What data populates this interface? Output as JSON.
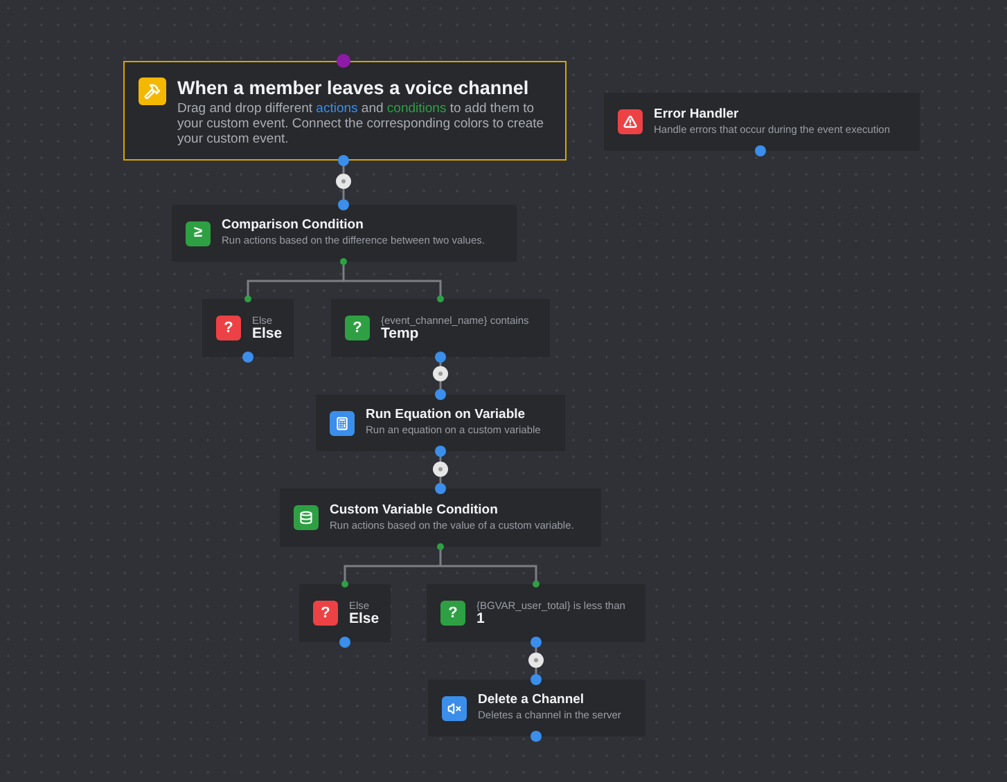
{
  "nodes": [
    {
      "kind": "trigger",
      "color": "#f5b800",
      "title": "When a member leaves a voice channel",
      "description": [
        {
          "text": "Drag and drop different "
        },
        {
          "text": "actions",
          "kind": "action"
        },
        {
          "text": " and "
        },
        {
          "text": "conditions",
          "kind": "condition"
        },
        {
          "text": " to add them to your custom event. Connect the corresponding colors to create your custom event."
        }
      ]
    },
    {
      "kind": "block",
      "color": "#ed4245",
      "title": "Error Handler",
      "subtitle": "Handle errors that occur during the event execution"
    },
    {
      "kind": "block",
      "glyph": "≥",
      "color": "#2ea043",
      "title": "Comparison Condition",
      "subtitle": "Run actions based on the difference between two values."
    },
    {
      "kind": "branch",
      "glyph": "?",
      "color": "#ed4245",
      "label": "Else",
      "title": "Else"
    },
    {
      "kind": "branch",
      "glyph": "?",
      "color": "#2ea043",
      "label": "{event_channel_name} contains",
      "title": "Temp"
    },
    {
      "kind": "block",
      "color": "#3b8eea",
      "title": "Run Equation on Variable",
      "subtitle": "Run an equation on a custom variable"
    },
    {
      "kind": "block",
      "color": "#2ea043",
      "title": "Custom Variable Condition",
      "subtitle": "Run actions based on the value of a custom variable."
    },
    {
      "kind": "branch",
      "glyph": "?",
      "color": "#ed4245",
      "label": "Else",
      "title": "Else"
    },
    {
      "kind": "branch",
      "glyph": "?",
      "color": "#2ea043",
      "label": "{BGVAR_user_total} is less than",
      "title": "1"
    },
    {
      "kind": "block",
      "color": "#3b8eea",
      "title": "Delete a Channel",
      "subtitle": "Deletes a channel in the server"
    }
  ]
}
